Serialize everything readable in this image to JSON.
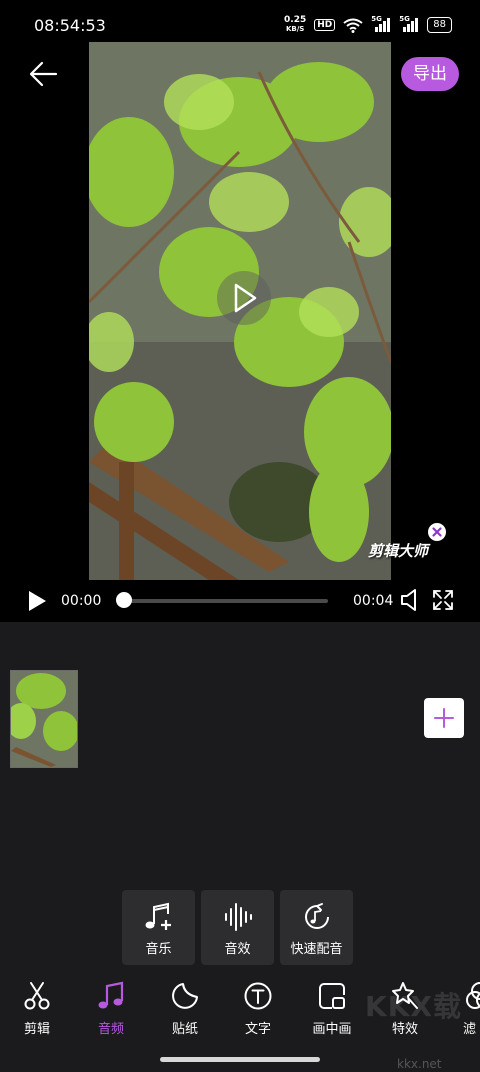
{
  "status_bar": {
    "time": "08:54:53",
    "net_speed_value": "0.25",
    "net_speed_unit": "KB/S",
    "hd_badge": "HD",
    "sim1_label": "5G",
    "sim2_label": "5G",
    "battery": "88"
  },
  "header": {
    "back_icon": "arrow-left-icon",
    "export_label": "导出",
    "accent_color": "#b75ae0"
  },
  "preview": {
    "play_icon": "play-circle-icon",
    "watermark_text": "剪辑大师"
  },
  "playback": {
    "current_time": "00:00",
    "duration": "00:04",
    "progress": 0.0
  },
  "timeline": {
    "add_icon": "plus-icon"
  },
  "audio_menu": [
    {
      "label": "音乐",
      "icon": "music-add-icon"
    },
    {
      "label": "音效",
      "icon": "sound-wave-icon"
    },
    {
      "label": "快速配音",
      "icon": "dubbing-icon"
    }
  ],
  "bottom_nav": [
    {
      "label": "剪辑",
      "icon": "scissors-icon",
      "active": false
    },
    {
      "label": "音频",
      "icon": "music-note-icon",
      "active": true
    },
    {
      "label": "贴纸",
      "icon": "sticker-icon",
      "active": false
    },
    {
      "label": "文字",
      "icon": "text-icon",
      "active": false
    },
    {
      "label": "画中画",
      "icon": "picture-in-picture-icon",
      "active": false
    },
    {
      "label": "特效",
      "icon": "magic-wand-icon",
      "active": false
    },
    {
      "label": "滤",
      "icon": "filter-icon",
      "active": false
    }
  ],
  "site_watermark": {
    "logo_text": "KKX载",
    "url": "kkx.net"
  }
}
